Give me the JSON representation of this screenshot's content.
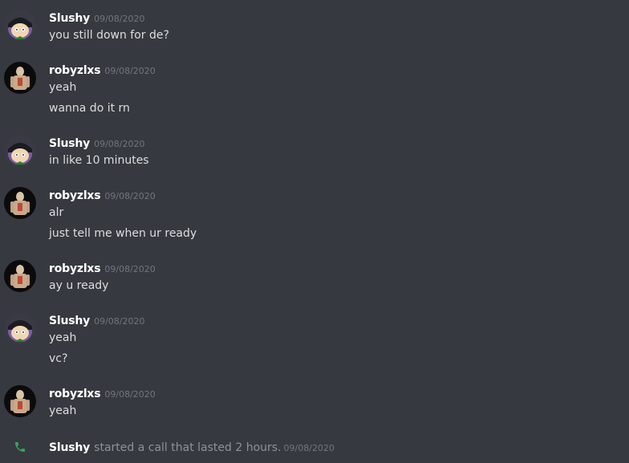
{
  "messages": [
    {
      "author": "Slushy",
      "timestamp": "09/08/2020",
      "avatar": "slushy-avatar",
      "lines": [
        "you still down for de?"
      ]
    },
    {
      "author": "robyzlxs",
      "timestamp": "09/08/2020",
      "avatar": "robyzlxs-avatar",
      "lines": [
        "yeah",
        "wanna do it rn"
      ]
    },
    {
      "author": "Slushy",
      "timestamp": "09/08/2020",
      "avatar": "slushy-avatar",
      "lines": [
        "in like 10 minutes"
      ]
    },
    {
      "author": "robyzlxs",
      "timestamp": "09/08/2020",
      "avatar": "robyzlxs-avatar",
      "lines": [
        "alr",
        "just tell me when ur ready"
      ]
    },
    {
      "author": "robyzlxs",
      "timestamp": "09/08/2020",
      "avatar": "robyzlxs-avatar",
      "lines": [
        "ay u ready"
      ]
    },
    {
      "author": "Slushy",
      "timestamp": "09/08/2020",
      "avatar": "slushy-avatar",
      "lines": [
        "yeah",
        "vc?"
      ]
    },
    {
      "author": "robyzlxs",
      "timestamp": "09/08/2020",
      "avatar": "robyzlxs-avatar",
      "lines": [
        "yeah"
      ]
    }
  ],
  "system_message": {
    "icon": "phone-icon",
    "author": "Slushy",
    "text": "started a call that lasted 2 hours.",
    "timestamp": "09/08/2020"
  },
  "colors": {
    "background": "#36393f",
    "username": "#ffffff",
    "message_text": "#dcddde",
    "timestamp": "#72767d",
    "call_icon": "#3ba55c"
  }
}
